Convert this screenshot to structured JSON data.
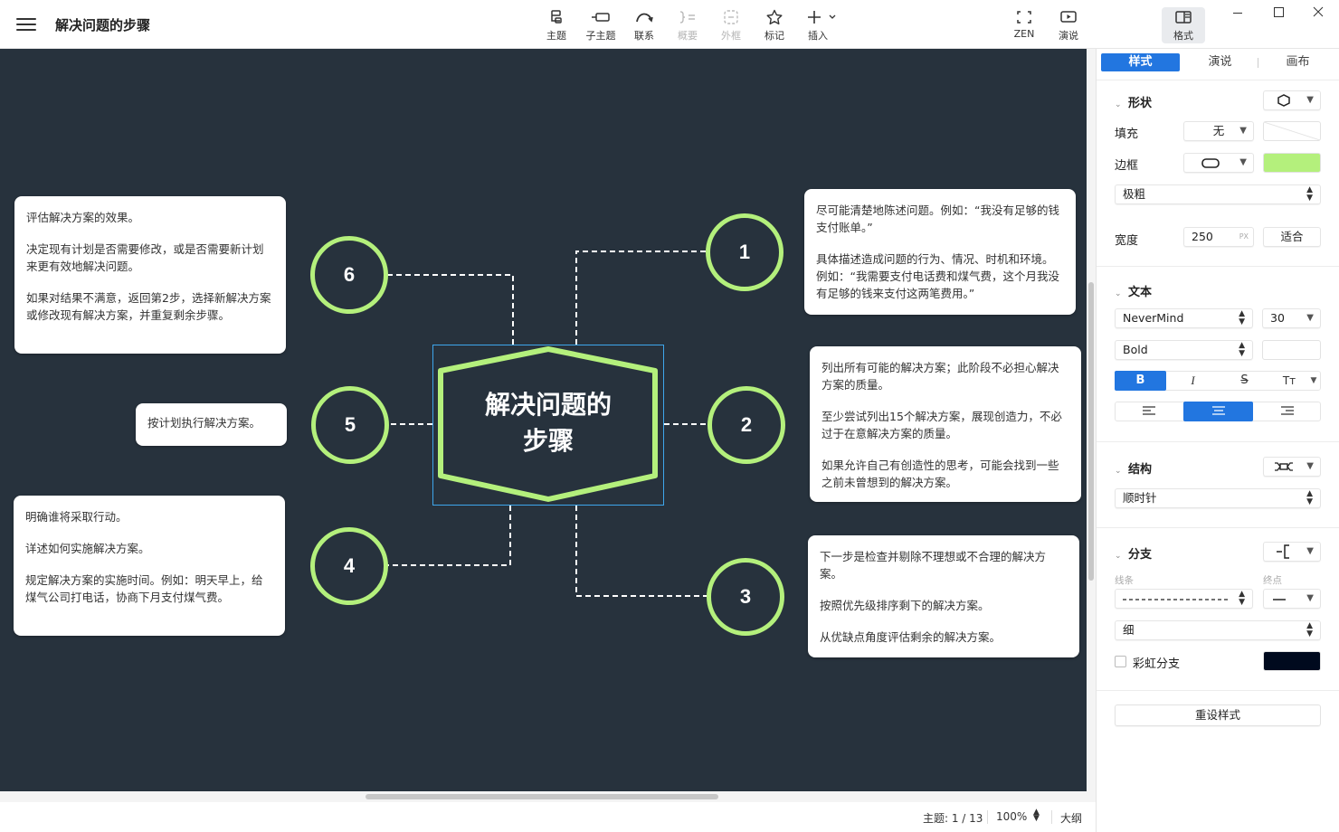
{
  "app": {
    "doc_title": "解决问题的步骤"
  },
  "toolbar": {
    "topic": "主题",
    "subtopic": "子主题",
    "relationship": "联系",
    "summary": "概要",
    "boundary": "外框",
    "marker": "标记",
    "insert": "插入",
    "zen": "ZEN",
    "pitch": "演说",
    "format": "格式"
  },
  "icons": [
    "menu-icon",
    "topic-icon",
    "subtopic-icon",
    "relationship-icon",
    "summary-icon",
    "boundary-icon",
    "star-icon",
    "plus-icon",
    "fullscreen-icon",
    "play-icon",
    "format-panel-icon",
    "minimize-icon",
    "maximize-icon",
    "close-icon"
  ],
  "colors": {
    "canvas_bg": "#27323d",
    "accent_green": "#b4f07c",
    "selection_blue": "#3ea6ec",
    "panel_accent": "#2276e0",
    "rainbow_swatch": "#000a1e"
  },
  "mindmap": {
    "central_topic_line1": "解决问题的",
    "central_topic_line2": "步骤",
    "branches": [
      {
        "number": "1",
        "notes": [
          "尽可能清楚地陈述问题。例如：“我没有足够的钱支付账单。”",
          "具体描述造成问题的行为、情况、时机和环境。例如：“我需要支付电话费和煤气费，这个月我没有足够的钱来支付这两笔费用。”"
        ]
      },
      {
        "number": "2",
        "notes": [
          "列出所有可能的解决方案；此阶段不必担心解决方案的质量。",
          "至少尝试列出15个解决方案，展现创造力，不必过于在意解决方案的质量。",
          "如果允许自己有创造性的思考，可能会找到一些之前未曾想到的解决方案。"
        ]
      },
      {
        "number": "3",
        "notes": [
          "下一步是检查并剔除不理想或不合理的解决方案。",
          "按照优先级排序剩下的解决方案。",
          "从优缺点角度评估剩余的解决方案。"
        ]
      },
      {
        "number": "4",
        "notes": [
          "明确谁将采取行动。",
          "详述如何实施解决方案。",
          "规定解决方案的实施时间。例如：明天早上，给煤气公司打电话，协商下月支付煤气费。"
        ]
      },
      {
        "number": "5",
        "notes": [
          "按计划执行解决方案。"
        ]
      },
      {
        "number": "6",
        "notes": [
          "评估解决方案的效果。",
          "决定现有计划是否需要修改，或是否需要新计划来更有效地解决问题。",
          "如果对结果不满意，返回第2步，选择新解决方案或修改现有解决方案，并重复剩余步骤。"
        ]
      }
    ]
  },
  "status": {
    "topic_count": "主题: 1 / 13",
    "zoom": "100%",
    "outline": "大纲"
  },
  "panel": {
    "tabs": [
      "样式",
      "演说",
      "画布"
    ],
    "shape": {
      "title": "形状",
      "fill_label": "填充",
      "fill_value": "无",
      "border_label": "边框",
      "border_color": "#b4f07c",
      "border_weight": "极粗",
      "width_label": "宽度",
      "width_value": "250",
      "width_unit": "PX",
      "fit_button": "适合"
    },
    "text": {
      "title": "文本",
      "font": "NeverMind",
      "size": "30",
      "weight": "Bold",
      "bold": "B",
      "italic": "I",
      "strike": "S",
      "case": "Tт"
    },
    "structure": {
      "title": "结构",
      "value": "顺时针"
    },
    "branch": {
      "title": "分支",
      "line_label": "线条",
      "end_label": "终点",
      "line_thickness": "细",
      "rainbow_label": "彩虹分支"
    },
    "reset_button": "重设样式"
  }
}
